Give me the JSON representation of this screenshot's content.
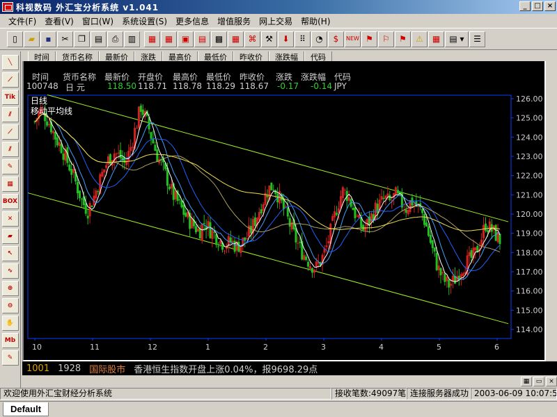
{
  "window": {
    "title": "科视数码 外汇宝分析系统 v1.041"
  },
  "menu": [
    "文件(F)",
    "查看(V)",
    "窗口(W)",
    "系统设置(S)",
    "更多信息",
    "增值服务",
    "网上交易",
    "帮助(H)"
  ],
  "ghost_header": [
    "时间",
    "货币名称",
    "最新价",
    "涨跌",
    "最高价",
    "最低价",
    "昨收价",
    "涨跌幅",
    "代码"
  ],
  "quote": {
    "headers": [
      "时间",
      "货币名称",
      "最新价",
      "开盘价",
      "最高价",
      "最低价",
      "昨收价",
      "涨跌",
      "涨跌幅",
      "代码"
    ],
    "values": {
      "time": "100748",
      "name": "日  元",
      "last": "118.50",
      "open": "118.71",
      "high": "118.78",
      "low": "118.29",
      "prev_close": "118.67",
      "change": "-0.17",
      "change_pct": "-0.14",
      "code": "JPY"
    }
  },
  "chart": {
    "label_period": "日线",
    "label_indicator": "移动平均线",
    "colors": {
      "bg": "#000000",
      "border": "#0a3cff",
      "axis_text": "#d0d0d0",
      "up": "#d02020",
      "down": "#20c020",
      "channel": "#a0f020",
      "ma_white": "#ffffff",
      "ma_yellow": "#f0e050",
      "ma_blue": "#2060ff",
      "ma_cyan": "#40a0ff",
      "ma_olive": "#b0a060"
    }
  },
  "chart_data": {
    "type": "candlestick",
    "ylim": [
      114,
      126
    ],
    "yticks": [
      "126.00",
      "125.00",
      "124.00",
      "123.00",
      "122.00",
      "121.00",
      "120.00",
      "119.00",
      "118.00",
      "117.00",
      "116.00",
      "115.00",
      "114.00"
    ],
    "xticks": [
      "10",
      "11",
      "12",
      "1",
      "2",
      "3",
      "4",
      "5",
      "6"
    ],
    "channel_upper": [
      126.2,
      119.6
    ],
    "channel_lower": [
      121.1,
      114.3
    ],
    "close_path": [
      124.8,
      125.4,
      125.1,
      124.6,
      123.9,
      123.5,
      122.8,
      122.2,
      121.4,
      120.6,
      120.2,
      120.8,
      121.6,
      122.3,
      122.9,
      123.2,
      123.0,
      122.6,
      123.4,
      124.5,
      125.6,
      124.9,
      124.0,
      123.1,
      122.5,
      121.8,
      121.0,
      120.6,
      120.1,
      119.7,
      119.4,
      119.1,
      119.6,
      119.2,
      118.9,
      118.6,
      118.4,
      118.6,
      118.3,
      118.5,
      118.8,
      119.3,
      120.0,
      120.7,
      121.3,
      121.5,
      120.9,
      120.2,
      119.5,
      118.8,
      118.2,
      117.8,
      117.4,
      117.2,
      117.6,
      118.3,
      119.3,
      120.4,
      121.2,
      121.0,
      120.3,
      119.6,
      119.2,
      119.6,
      120.2,
      120.5,
      120.8,
      120.6,
      121.0,
      120.6,
      120.3,
      120.7,
      120.4,
      120.1,
      119.2,
      118.1,
      117.2,
      116.6,
      116.3,
      116.5,
      117.0,
      117.4,
      117.6,
      117.9,
      118.6,
      119.5,
      119.2,
      118.9,
      118.5
    ]
  },
  "ticker": {
    "code": "1001",
    "time": "1928",
    "category": "国际股市",
    "message": "香港恒生指数开盘上涨0.04%，报9698.29点"
  },
  "status": {
    "welcome": "欢迎使用外汇宝财经分析系统",
    "received": "接收笔数:49097笔",
    "server": "连接服务器成功",
    "datetime": "2003-06-09  10:07:52"
  },
  "tabs": {
    "default": "Default"
  }
}
